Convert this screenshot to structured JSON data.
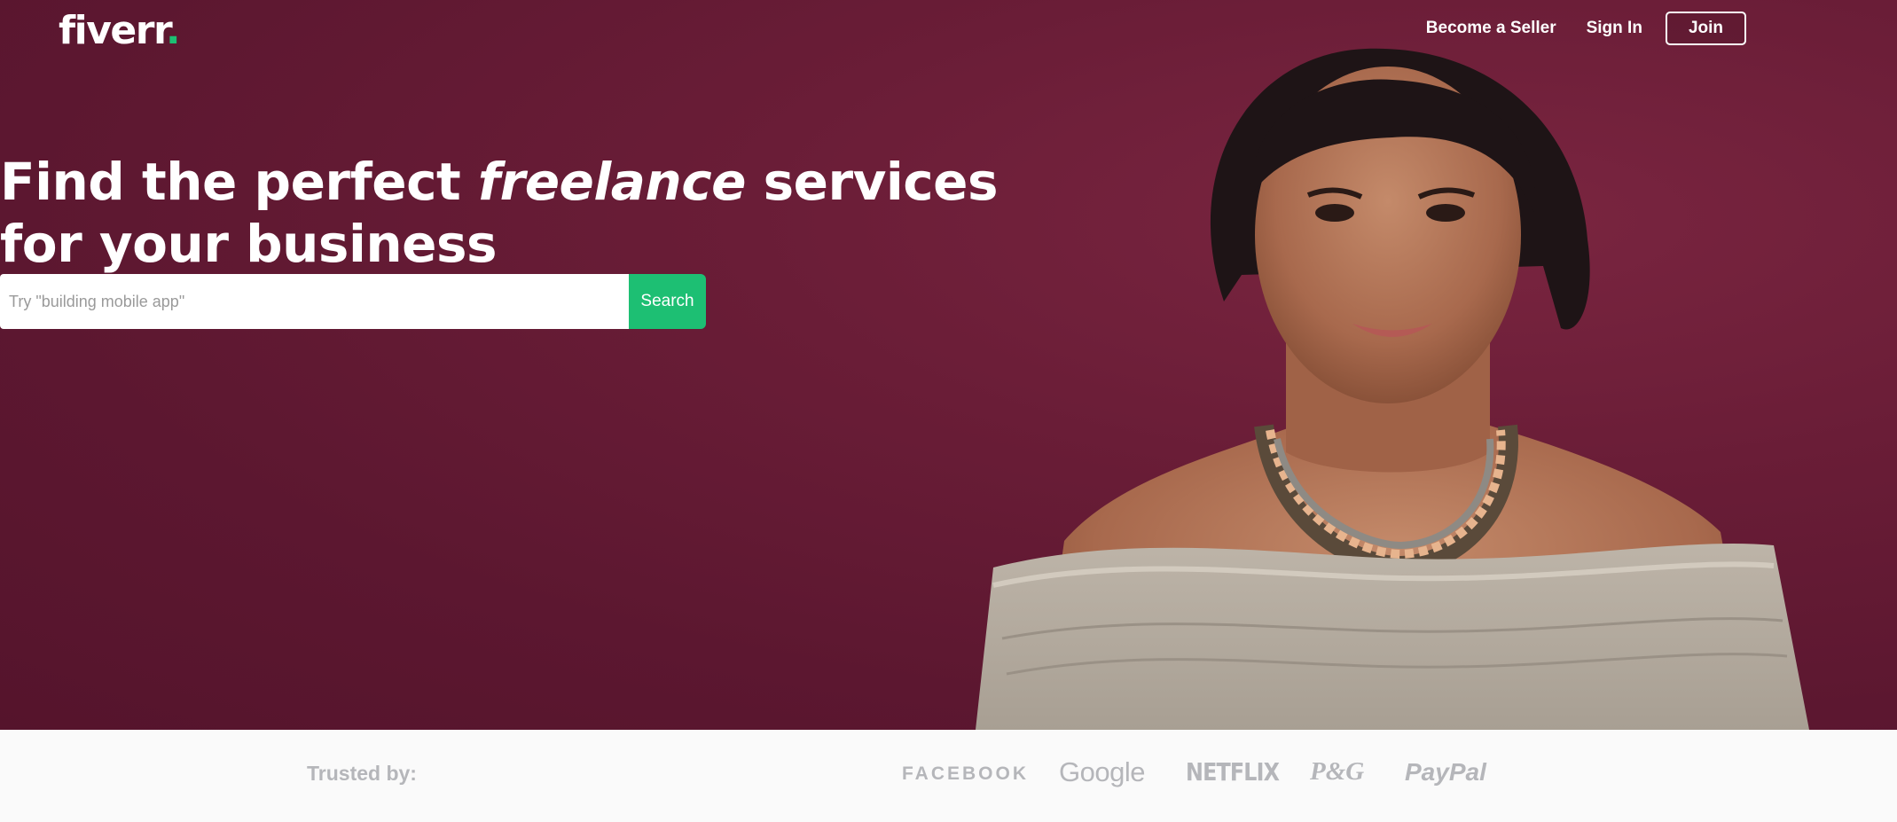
{
  "header": {
    "logo_text": "fiverr",
    "logo_dot": ".",
    "nav": {
      "become_seller": "Become a Seller",
      "sign_in": "Sign In",
      "join": "Join"
    }
  },
  "hero": {
    "headline_part1": "Find the perfect ",
    "headline_italic": "freelance",
    "headline_part2": " services",
    "headline_line2": "for your business",
    "search": {
      "placeholder": "Try \"building mobile app\"",
      "value": "",
      "button_label": "Search"
    }
  },
  "trusted": {
    "label": "Trusted by:",
    "brands": [
      "FACEBOOK",
      "Google",
      "NETFLIX",
      "P&G",
      "PayPal"
    ]
  },
  "colors": {
    "hero_background": "#5c1730",
    "accent_green": "#1dbf73",
    "trusted_background": "#fafafa",
    "trusted_text": "#b5b6ba"
  }
}
